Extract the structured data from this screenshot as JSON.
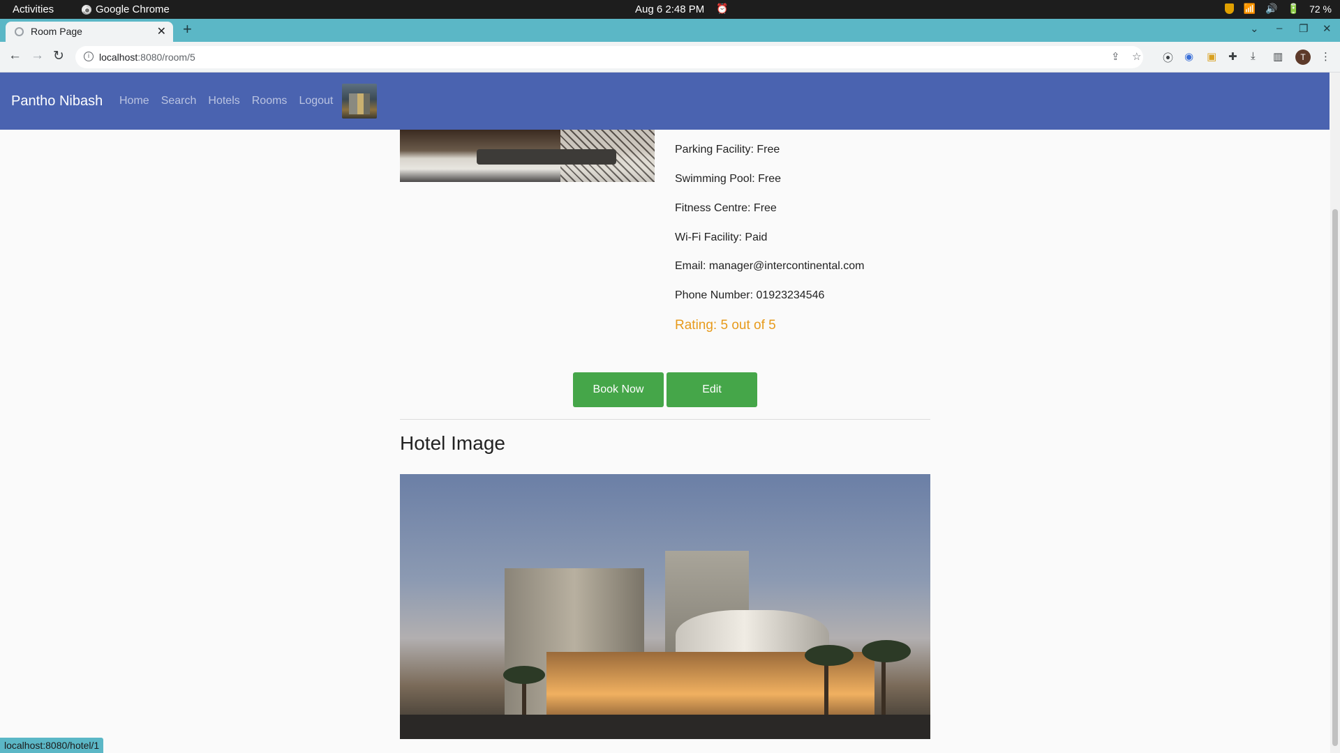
{
  "system": {
    "activities": "Activities",
    "app_name": "Google Chrome",
    "clock": "Aug 6  2:48 PM",
    "battery": "72 %"
  },
  "browser": {
    "tab_title": "Room Page",
    "url_host": "localhost",
    "url_path": ":8080/room/5",
    "status_url": "localhost:8080/hotel/1",
    "profile_initial": "T"
  },
  "navbar": {
    "brand": "Pantho Nibash",
    "links": [
      "Home",
      "Search",
      "Hotels",
      "Rooms",
      "Logout"
    ]
  },
  "details": {
    "parking": "Parking Facility: Free",
    "pool": "Swimming Pool: Free",
    "fitness": "Fitness Centre: Free",
    "wifi": "Wi-Fi Facility: Paid",
    "email": "Email: manager@intercontinental.com",
    "phone": "Phone Number: 01923234546",
    "rating": "Rating: 5 out of 5"
  },
  "actions": {
    "book_label": "Book Now",
    "edit_label": "Edit"
  },
  "hotel_section": {
    "title": "Hotel Image"
  },
  "colors": {
    "navbar_bg": "#4a63b0",
    "button_green": "#45a649",
    "rating_orange": "#e79a1b",
    "tab_strip": "#5bb7c6"
  }
}
